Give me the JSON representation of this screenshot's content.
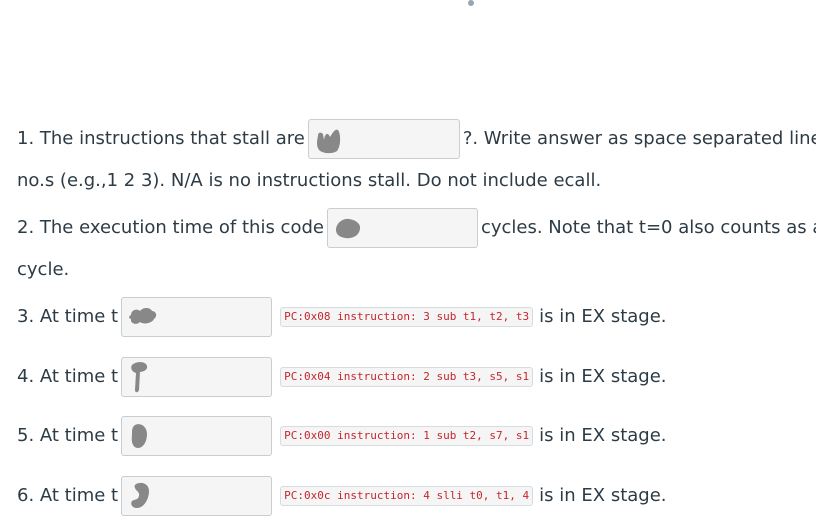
{
  "q1": {
    "before": "1. The instructions that stall are",
    "after": "?. Write answer as space separated line",
    "continuation": "no.s (e.g.,1 2 3). N/A is no instructions stall. Do not include ecall."
  },
  "q2": {
    "before": "2. The execution time of this code",
    "after": "cycles. Note that t=0 also counts as a",
    "continuation": "cycle."
  },
  "q3": {
    "before": "3. At time t",
    "code": "PC:0x08 instruction: 3 sub t1, t2, t3",
    "after": "is in EX stage."
  },
  "q4": {
    "before": "4. At time t",
    "code": "PC:0x04 instruction: 2 sub t3, s5, s1",
    "after": "is in EX stage."
  },
  "q5": {
    "before": "5. At time t",
    "code": "PC:0x00 instruction: 1 sub t2, s7, s1",
    "after": "is in EX stage."
  },
  "q6": {
    "before": "6. At time t",
    "code": "PC:0x0c instruction: 4 slli t0, t1, 4",
    "after": "is in EX stage."
  },
  "colors": {
    "text": "#2d3b45",
    "code_text": "#c4262e",
    "input_bg": "#f5f5f5",
    "input_border": "#c7cdd1"
  }
}
